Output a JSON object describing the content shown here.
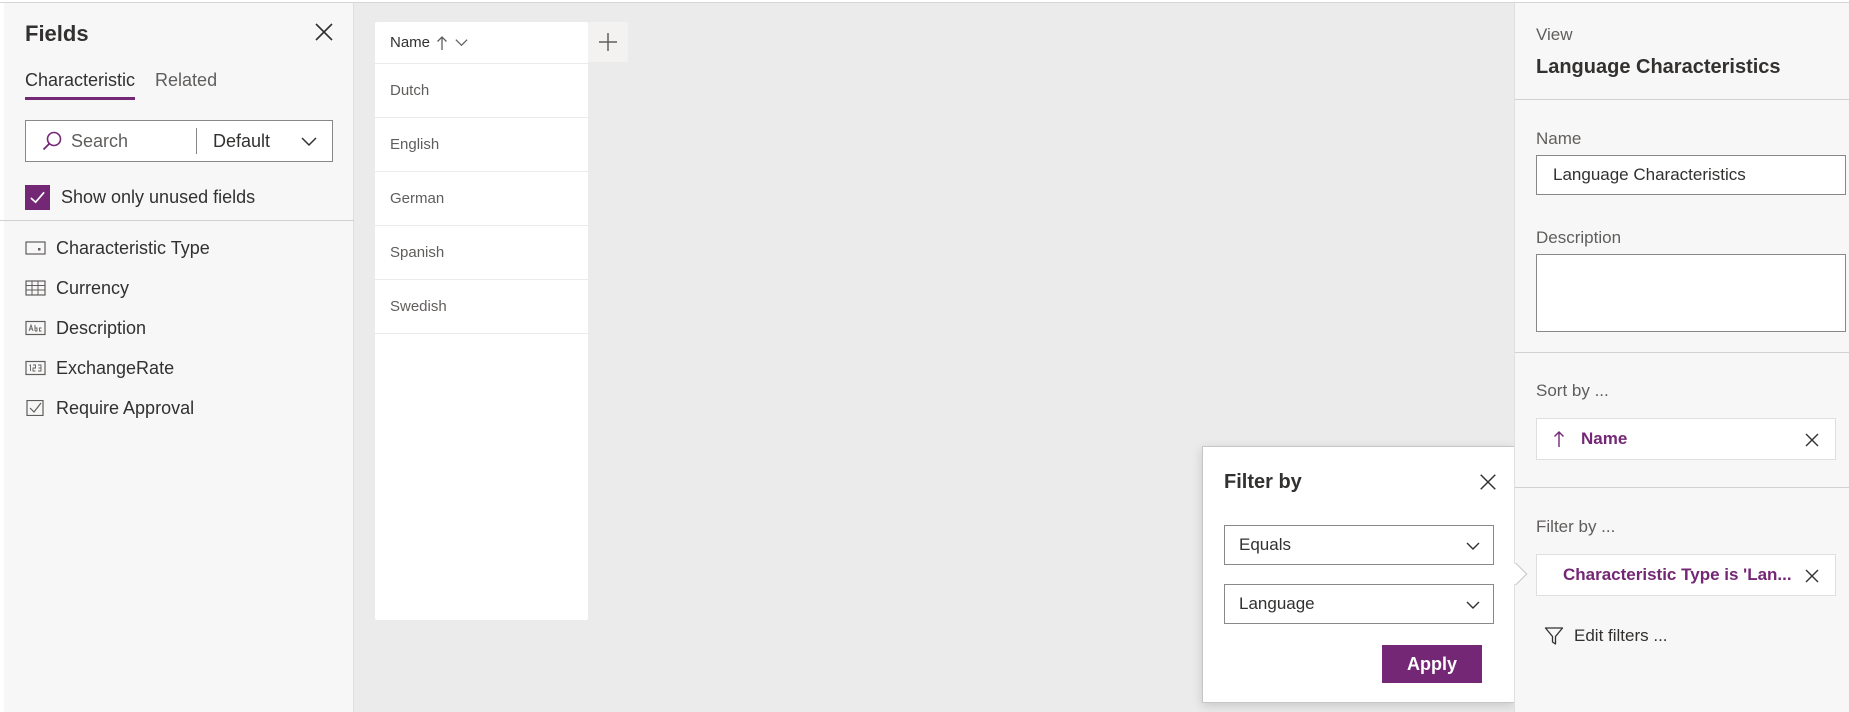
{
  "fields_panel": {
    "title": "Fields",
    "tabs": [
      {
        "label": "Characteristic",
        "active": true
      },
      {
        "label": "Related",
        "active": false
      }
    ],
    "search": {
      "placeholder": "Search",
      "dropdown_value": "Default"
    },
    "show_unused": {
      "label": "Show only unused fields",
      "checked": true
    },
    "fields": [
      {
        "label": "Characteristic Type",
        "icon": "lookup-icon"
      },
      {
        "label": "Currency",
        "icon": "currency-icon"
      },
      {
        "label": "Description",
        "icon": "text-field-icon"
      },
      {
        "label": "ExchangeRate",
        "icon": "number-field-icon"
      },
      {
        "label": "Require Approval",
        "icon": "checkbox-field-icon"
      }
    ]
  },
  "grid": {
    "column_header": "Name",
    "rows": [
      "Dutch",
      "English",
      "German",
      "Spanish",
      "Swedish"
    ]
  },
  "view_panel": {
    "section_label": "View",
    "title": "Language Characteristics",
    "name_label": "Name",
    "name_value": "Language Characteristics",
    "description_label": "Description",
    "description_value": "",
    "sort_label": "Sort by ...",
    "sort_chip": "Name",
    "filter_label": "Filter by ...",
    "filter_chip": "Characteristic Type is 'Lan...",
    "edit_filters": "Edit filters ..."
  },
  "filter_popup": {
    "title": "Filter by",
    "operator": "Equals",
    "value": "Language",
    "apply_label": "Apply"
  },
  "colors": {
    "accent": "#742774",
    "background": "#ebebeb",
    "panel": "#f7f7f7"
  }
}
